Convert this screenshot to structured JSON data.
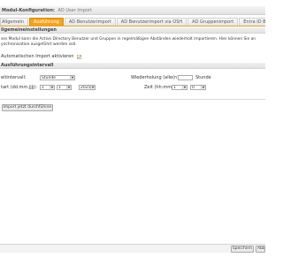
{
  "header": {
    "title_label": "Modul-Konfiguration:",
    "title_value": "AD User Import"
  },
  "tabs": [
    {
      "label": "Allgemein",
      "active": false
    },
    {
      "label": "Ausführung",
      "active": true
    },
    {
      "label": "AD Benutzerimport",
      "active": false
    },
    {
      "label": "AD Benutzerimport via OSH",
      "active": false
    },
    {
      "label": "AD Gruppenimport",
      "active": false
    },
    {
      "label": "Entra ID Benutzerimport",
      "active": false
    }
  ],
  "general_settings": {
    "section_title": "Ilgemeineinstellungen",
    "description_line1": "ses Modul kann die Active Directory Benutzer und Gruppen in regelmäßigen Abständen wiederholt importieren. Hier können Sie an",
    "description_line2": "ynchronisation ausgeführt werden soll.",
    "auto_import_label": "Automatischen Import aktivieren",
    "auto_import_checked": true
  },
  "interval": {
    "section_title": "Ausführungsintervall",
    "interval_label": "eitintervall:",
    "interval_value": "Stunde",
    "repeat_label": "Wiederholung (alle(n)",
    "repeat_value": "",
    "repeat_unit": "Stunde",
    "start_label": "tart (dd.mm.jjjj):",
    "start_day": "1",
    "start_month": "1",
    "start_year": "2025",
    "time_label": "Zeit (hh:mm):",
    "time_hour": "1",
    "time_minute": "0",
    "run_now_label": "Import jetzt durchführen"
  },
  "footer": {
    "save_label": "Speichern",
    "cancel_label": "Abb"
  },
  "colors": {
    "accent": "#f3a31e",
    "checkmark": "#e39a1c"
  },
  "icons": {
    "checkbox": "checkbox-checked-icon",
    "dropdown": "chevron-down-icon"
  }
}
